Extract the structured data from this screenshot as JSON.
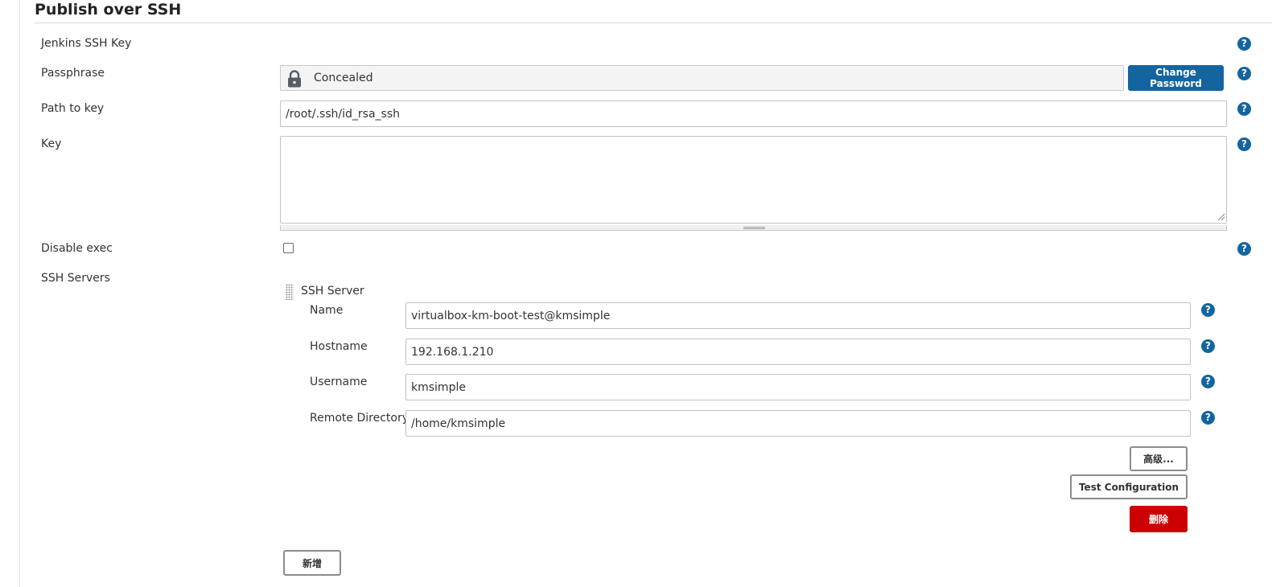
{
  "section": {
    "title": "Publish over SSH"
  },
  "rows": {
    "jenkins_ssh_key": {
      "label": "Jenkins SSH Key"
    },
    "passphrase": {
      "label": "Passphrase",
      "concealed_text": "Concealed",
      "change_button": "Change Password"
    },
    "path_to_key": {
      "label": "Path to key",
      "value": "/root/.ssh/id_rsa_ssh"
    },
    "key": {
      "label": "Key",
      "value": ""
    },
    "disable_exec": {
      "label": "Disable exec",
      "checked": false
    },
    "ssh_servers": {
      "label": "SSH Servers"
    }
  },
  "server": {
    "header": "SSH Server",
    "name": {
      "label": "Name",
      "value": "virtualbox-km-boot-test@kmsimple"
    },
    "hostname": {
      "label": "Hostname",
      "value": "192.168.1.210"
    },
    "username": {
      "label": "Username",
      "value": "kmsimple"
    },
    "remote_directory": {
      "label": "Remote Directory",
      "value": "/home/kmsimple"
    },
    "advanced_button": "高级...",
    "test_button": "Test Configuration",
    "delete_button": "删除"
  },
  "add_button": "新增",
  "help_glyph": "?",
  "colors": {
    "accent": "#13659f",
    "danger": "#cc0003",
    "border": "#c2c2c2"
  },
  "icons": [
    "lock-icon",
    "help-icon",
    "drag-handle-icon",
    "resize-grip-icon"
  ]
}
